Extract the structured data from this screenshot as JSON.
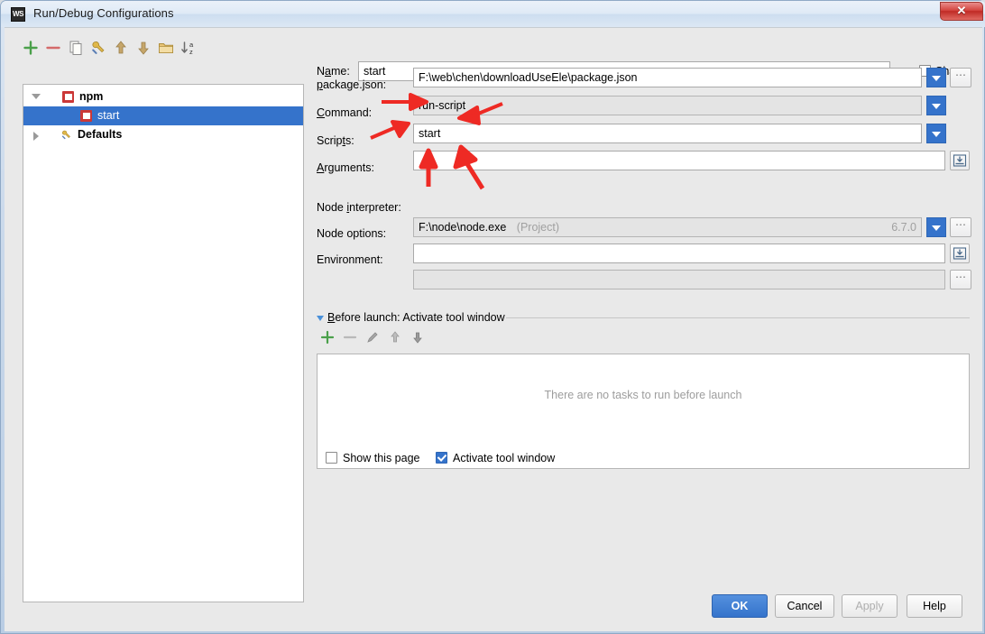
{
  "window": {
    "title": "Run/Debug Configurations",
    "app_icon": "webstorm-icon",
    "app_icon_text": "WS",
    "close_label": "✕"
  },
  "tree_toolbar": {
    "items": [
      {
        "name": "add-configuration",
        "icon": "plus-icon"
      },
      {
        "name": "remove-configuration",
        "icon": "minus-icon"
      },
      {
        "name": "copy-configuration",
        "icon": "copy-icon"
      },
      {
        "name": "edit-defaults",
        "icon": "wrench-icon"
      },
      {
        "name": "move-up",
        "icon": "arrow-up-icon"
      },
      {
        "name": "move-down",
        "icon": "arrow-down-icon"
      },
      {
        "name": "create-folder",
        "icon": "folder-icon"
      },
      {
        "name": "sort-alphabetically",
        "icon": "sort-az-icon"
      }
    ]
  },
  "tree": {
    "nodes": [
      {
        "label": "npm",
        "icon": "npm-icon",
        "state": "expanded",
        "selected": false,
        "bold": true,
        "indent": 0
      },
      {
        "label": "start",
        "icon": "npm-icon",
        "state": "leaf",
        "selected": true,
        "bold": false,
        "indent": 1
      },
      {
        "label": "Defaults",
        "icon": "wrench-icon",
        "state": "collapsed",
        "selected": false,
        "bold": true,
        "indent": 0
      }
    ]
  },
  "form": {
    "name": {
      "label_pre": "N",
      "label_mn": "a",
      "label_post": "me:",
      "value": "start"
    },
    "share": {
      "label_pre": "",
      "label_mn": "S",
      "label_post": "hare",
      "checked": false
    },
    "package_json": {
      "label_pre": "",
      "label_mn": "p",
      "label_post": "ackage.json:",
      "value": "F:\\web\\chen\\downloadUseEle\\package.json"
    },
    "command": {
      "label_pre": "",
      "label_mn": "C",
      "label_post": "ommand:",
      "value": "run-script"
    },
    "scripts": {
      "label_pre": "Scrip",
      "label_mn": "t",
      "label_post": "s:",
      "value": "start"
    },
    "arguments": {
      "label_pre": "",
      "label_mn": "A",
      "label_post": "rguments:",
      "value": ""
    },
    "node_interpreter": {
      "label_pre": "Node ",
      "label_mn": "i",
      "label_post": "nterpreter:",
      "value": "F:\\node\\node.exe",
      "hint": "(Project)",
      "version": "6.7.0"
    },
    "node_options": {
      "label": "Node options:",
      "value": ""
    },
    "environment": {
      "label": "Environment:",
      "value": ""
    }
  },
  "before_launch": {
    "title_pre": "",
    "title_mn": "B",
    "title_post": "efore launch: Activate tool window",
    "toolbar": [
      {
        "name": "add-task",
        "icon": "plus-icon"
      },
      {
        "name": "remove-task",
        "icon": "minus-icon"
      },
      {
        "name": "edit-task",
        "icon": "pencil-icon"
      },
      {
        "name": "move-task-up",
        "icon": "arrow-up-icon"
      },
      {
        "name": "move-task-down",
        "icon": "arrow-down-icon"
      }
    ],
    "empty_text": "There are no tasks to run before launch",
    "show_page": {
      "label": "Show this page",
      "checked": false
    },
    "activate_tool_window": {
      "label": "Activate tool window",
      "checked": true
    }
  },
  "buttons": {
    "ok": "OK",
    "cancel": "Cancel",
    "apply": "Apply",
    "help": "Help"
  },
  "colors": {
    "accent": "#3573cb",
    "npm_red": "#cb3837",
    "annotation": "#ee2a24",
    "muted_text": "#9d9d9d"
  }
}
